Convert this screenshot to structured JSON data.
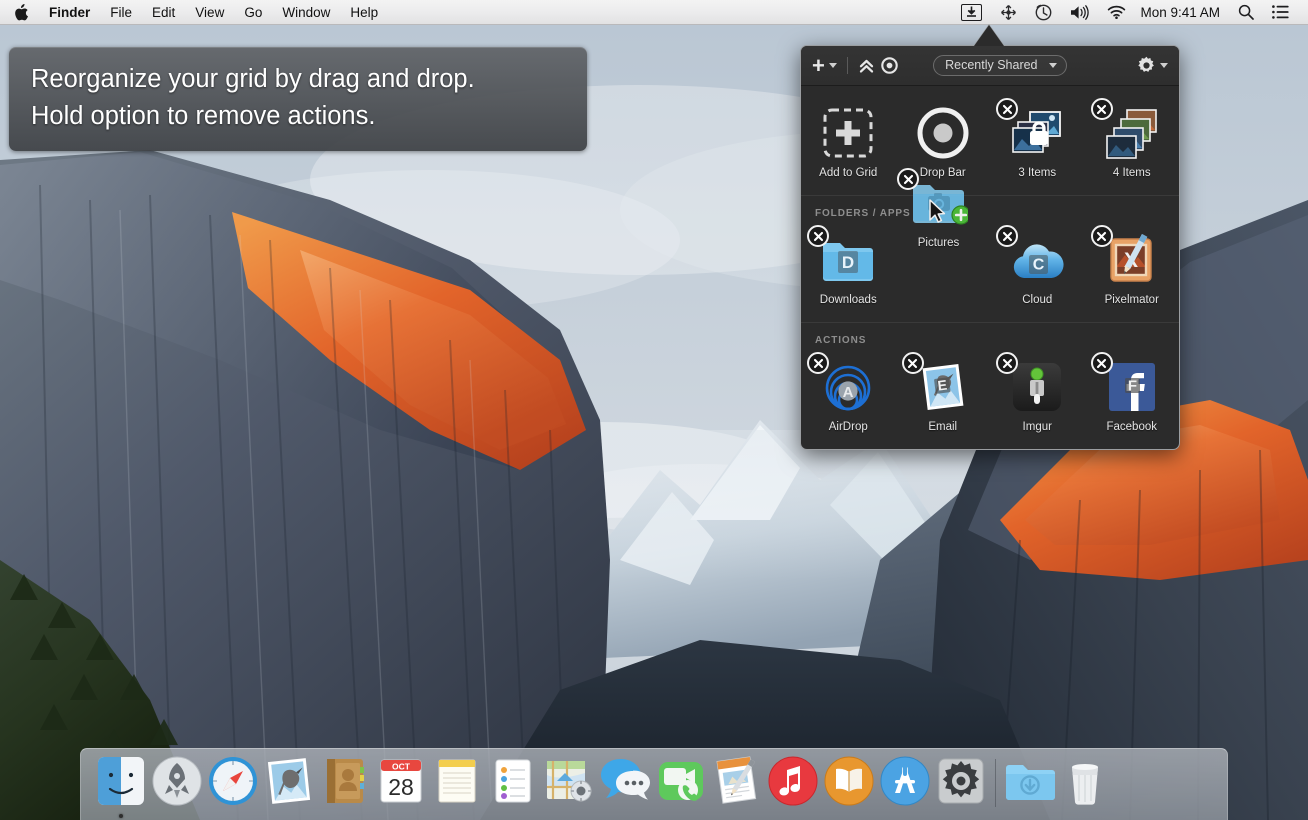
{
  "menubar": {
    "apple_icon": "apple-logo-icon",
    "items": [
      {
        "label": "Finder",
        "bold": true
      },
      {
        "label": "File",
        "bold": false
      },
      {
        "label": "Edit",
        "bold": false
      },
      {
        "label": "View",
        "bold": false
      },
      {
        "label": "Go",
        "bold": false
      },
      {
        "label": "Window",
        "bold": false
      },
      {
        "label": "Help",
        "bold": false
      }
    ],
    "status_icons": [
      {
        "name": "dropzone-download-icon",
        "active": true
      },
      {
        "name": "drag-move-icon",
        "active": false
      },
      {
        "name": "time-machine-icon",
        "active": false
      },
      {
        "name": "volume-icon",
        "active": false
      },
      {
        "name": "wifi-icon",
        "active": false
      }
    ],
    "clock": "Mon 9:41 AM",
    "search_icon": "spotlight-search-icon",
    "notification_icon": "notification-center-icon"
  },
  "caption": {
    "line1": "Reorganize your grid by drag and drop.",
    "line2": "Hold option to remove actions."
  },
  "popover": {
    "toolbar": {
      "add_label": "+",
      "add_menu_icon": "chevron-down-icon",
      "collapse_icon": "double-chevron-up-icon",
      "target_icon": "record-circle-icon",
      "filter_label": "Recently Shared",
      "filter_caret_icon": "chevron-down-icon",
      "settings_icon": "gear-icon",
      "settings_caret_icon": "chevron-down-icon"
    },
    "sections": [
      {
        "title": "",
        "items": [
          {
            "label": "Add to Grid",
            "icon": "add-to-grid-icon",
            "removable": false
          },
          {
            "label": "Drop Bar",
            "icon": "drop-bar-icon",
            "removable": false
          },
          {
            "label": "3 Items",
            "icon": "photo-stack-locked-icon",
            "removable": true
          },
          {
            "label": "4 Items",
            "icon": "photo-stack-icon",
            "removable": true
          }
        ]
      },
      {
        "title": "FOLDERS / APPS",
        "items": [
          {
            "label": "Downloads",
            "icon": "downloads-folder-icon",
            "removable": true
          },
          {
            "label": "",
            "icon": "empty-slot",
            "removable": false
          },
          {
            "label": "Cloud",
            "icon": "cloud-folder-icon",
            "removable": true
          },
          {
            "label": "Pixelmator",
            "icon": "pixelmator-app-icon",
            "removable": true
          }
        ],
        "dragging_item": {
          "label": "Pictures",
          "icon": "pictures-folder-icon",
          "removable": true,
          "badge": "+"
        }
      },
      {
        "title": "ACTIONS",
        "items": [
          {
            "label": "AirDrop",
            "icon": "airdrop-icon",
            "removable": true
          },
          {
            "label": "Email",
            "icon": "email-stamp-icon",
            "removable": true
          },
          {
            "label": "Imgur",
            "icon": "imgur-icon",
            "removable": true
          },
          {
            "label": "Facebook",
            "icon": "facebook-icon",
            "removable": true
          }
        ]
      }
    ]
  },
  "dock": {
    "items": [
      {
        "name": "finder",
        "label": "Finder",
        "running": true
      },
      {
        "name": "launchpad",
        "label": "Launchpad",
        "running": false
      },
      {
        "name": "safari",
        "label": "Safari",
        "running": false
      },
      {
        "name": "mail",
        "label": "Mail",
        "running": false
      },
      {
        "name": "contacts",
        "label": "Contacts",
        "running": false
      },
      {
        "name": "calendar",
        "label": "Calendar",
        "running": false,
        "month": "OCT",
        "day": "28"
      },
      {
        "name": "notes",
        "label": "Notes",
        "running": false
      },
      {
        "name": "reminders",
        "label": "Reminders",
        "running": false
      },
      {
        "name": "maps",
        "label": "Maps",
        "running": false
      },
      {
        "name": "messages",
        "label": "Messages",
        "running": false
      },
      {
        "name": "facetime",
        "label": "FaceTime",
        "running": false
      },
      {
        "name": "pages",
        "label": "Pages",
        "running": false
      },
      {
        "name": "itunes",
        "label": "iTunes",
        "running": false
      },
      {
        "name": "ibooks",
        "label": "iBooks",
        "running": false
      },
      {
        "name": "appstore",
        "label": "App Store",
        "running": false
      },
      {
        "name": "system-preferences",
        "label": "System Preferences",
        "running": false
      }
    ],
    "right_items": [
      {
        "name": "downloads-stack",
        "label": "Downloads"
      },
      {
        "name": "trash",
        "label": "Trash"
      }
    ]
  },
  "colors": {
    "panel_bg": "#2b2b2b",
    "panel_border": "#9b9ea1",
    "menubar_bg": "#ececed",
    "accent_blue": "#3478f6",
    "facebook_blue": "#3b5998",
    "airdrop_blue": "#1d6fd4",
    "folder_blue": "#6fc2ef",
    "badge_green": "#3fae2a",
    "caption_bg": "#5f6267"
  }
}
